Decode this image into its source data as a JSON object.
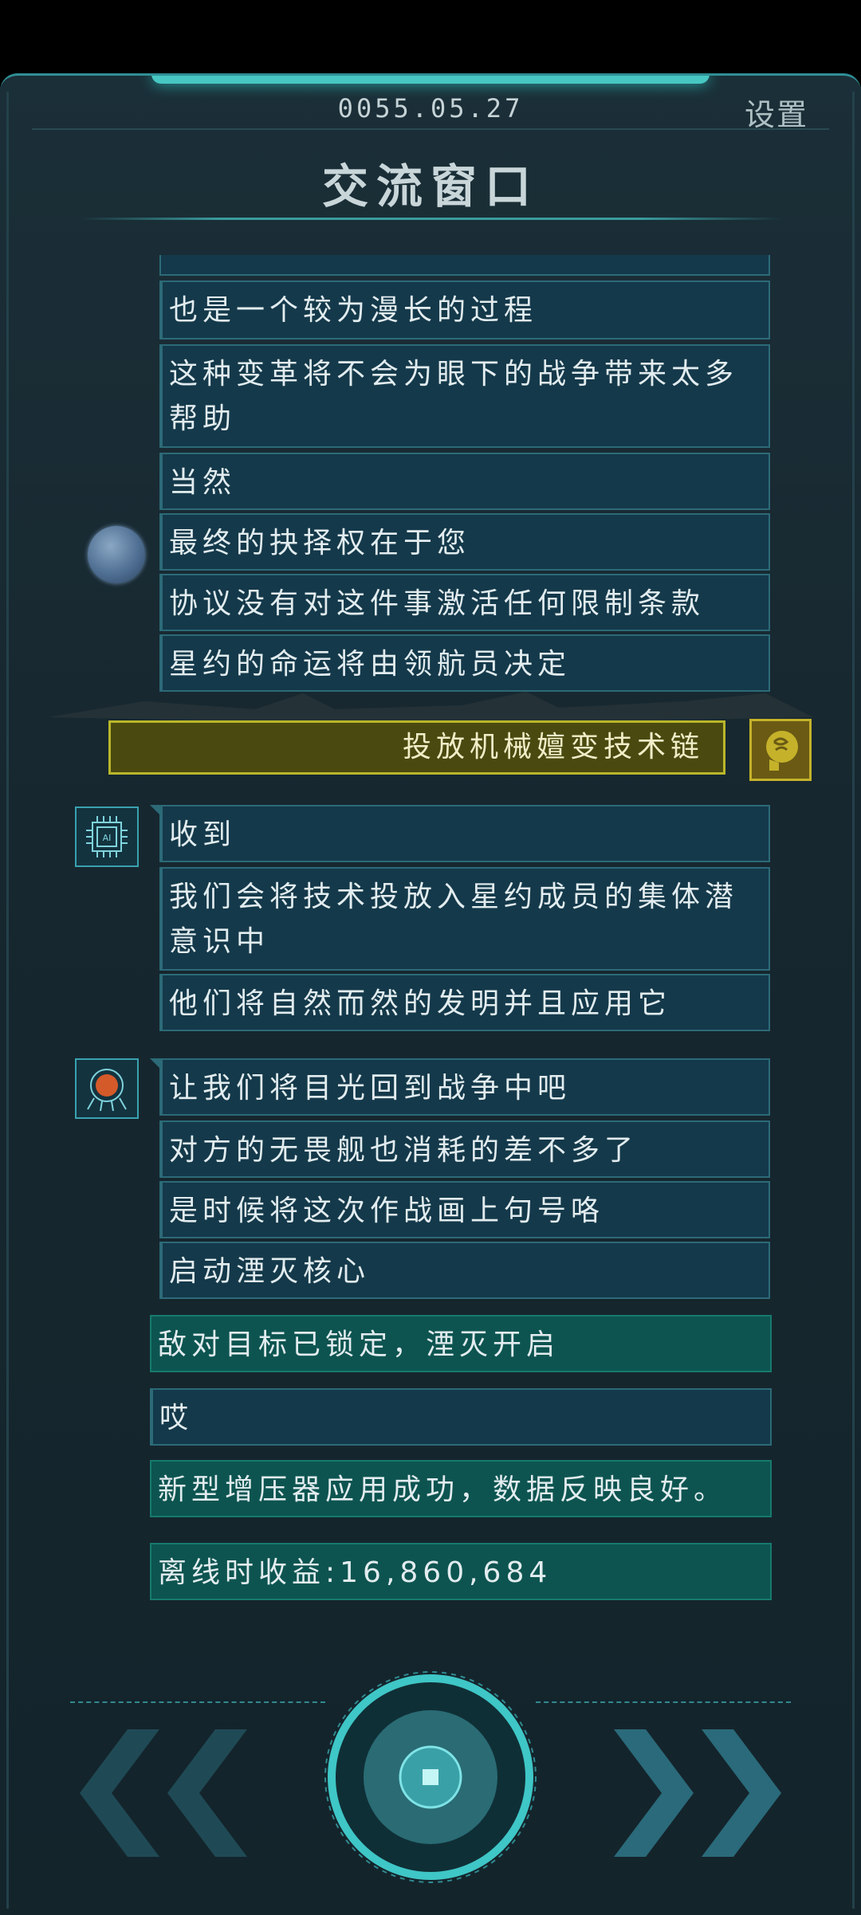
{
  "header": {
    "date": "0055.05.27",
    "settings_label": "设置",
    "title": "交流窗口"
  },
  "group1": {
    "messages": [
      "也是一个较为漫长的过程",
      "这种变革将不会为眼下的战争带来太多帮助",
      "当然",
      "最终的抉择权在于您",
      "协议没有对这件事激活任何限制条款",
      "星约的命运将由领航员决定"
    ]
  },
  "choice": {
    "label": "投放机械嬗变技术链"
  },
  "group2": {
    "avatar_text": "AI",
    "messages": [
      "收到",
      "我们会将技术投放入星约成员的集体潜意识中",
      "他们将自然而然的发明并且应用它"
    ]
  },
  "group3": {
    "messages": [
      "让我们将目光回到战争中吧",
      "对方的无畏舰也消耗的差不多了",
      "是时候将这次作战画上句号咯",
      "启动湮灭核心"
    ]
  },
  "system": {
    "lock_msg": "敌对目标已锁定，湮灭开启",
    "sigh_msg": "哎",
    "booster_msg": "新型增压器应用成功，数据反映良好。",
    "offline_msg": "离线时收益:16,860,684"
  },
  "colors": {
    "accent": "#48c7c2",
    "bubble": "#14394a",
    "system_bubble": "#0d5450",
    "choice": "#4a4a10"
  },
  "icons": {
    "planet": "planet-avatar-icon",
    "brain": "brain-icon",
    "ai_chip": "ai-chip-icon",
    "core": "core-avatar-icon",
    "prev": "double-chevron-left-icon",
    "next": "double-chevron-right-icon",
    "center": "core-button-icon"
  }
}
